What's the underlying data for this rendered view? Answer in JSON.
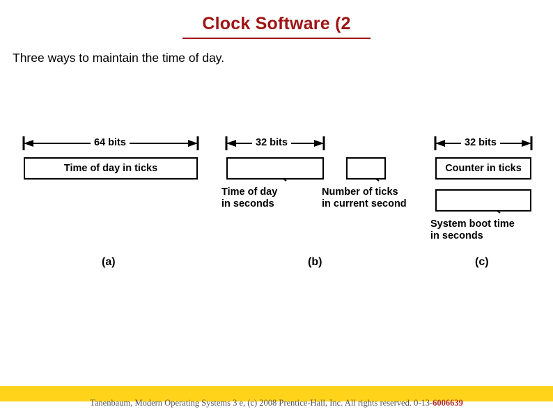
{
  "slide": {
    "title": "Clock Software (2",
    "body_text": "Three ways to maintain the time of day.",
    "title_color": "#9f1414",
    "footer_bar_color": "#ffd31a",
    "footer": {
      "text": "Tanenbaum, Modern Operating Systems 3 e, (c) 2008 Prentice-Hall, Inc. All rights reserved. 0-13-",
      "isbn": "6006639"
    }
  },
  "figure": {
    "panels": [
      {
        "id": "a",
        "caption": "(a)",
        "dimension": "64 bits",
        "box_label": "Time of day in ticks",
        "lower_box_label": "",
        "below_caption": ""
      },
      {
        "id": "b",
        "caption": "(b)",
        "dimension": "32 bits",
        "box_label": "",
        "left_caption": "Time of day\nin seconds",
        "right_caption": "Number of ticks\nin current second",
        "second_dimension": ""
      },
      {
        "id": "c",
        "caption": "(c)",
        "dimension": "32 bits",
        "box_label": "Counter in ticks",
        "lower_box_label": "",
        "below_caption": "System boot time\nin seconds"
      }
    ],
    "labels": {
      "bits64": "64 bits",
      "bits32_b": "32 bits",
      "bits32_c": "32 bits",
      "time_of_day_in_ticks": "Time of day in ticks",
      "counter_in_ticks": "Counter in ticks",
      "time_of_day_in_seconds_l1": "Time of day",
      "time_of_day_in_seconds_l2": "in seconds",
      "number_of_ticks_l1": "Number of ticks",
      "number_of_ticks_l2": "in current second",
      "system_boot_time_l1": "System boot time",
      "system_boot_time_l2": "in seconds",
      "caption_a": "(a)",
      "caption_b": "(b)",
      "caption_c": "(c)"
    }
  }
}
